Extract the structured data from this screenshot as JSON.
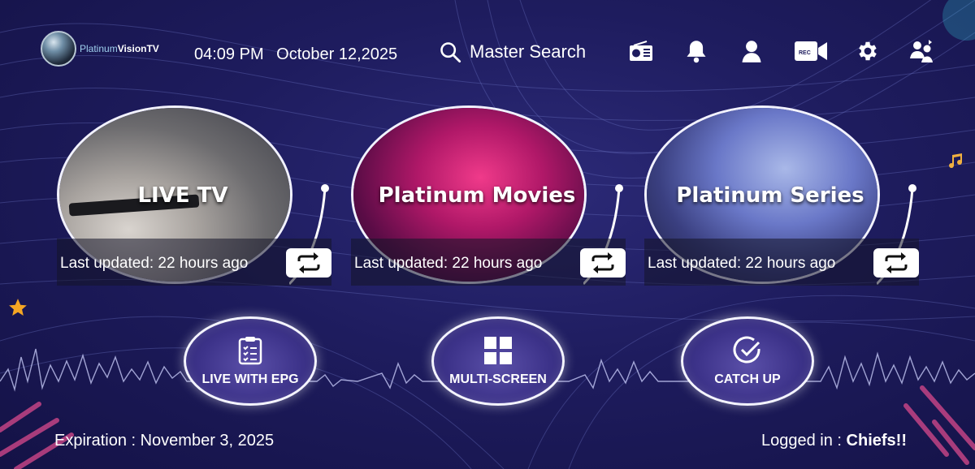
{
  "header": {
    "logo": {
      "name_part1": "Platinum",
      "name_part2": "VisionTV"
    },
    "time": "04:09 PM",
    "date": "October 12,2025",
    "search_label": "Master Search",
    "icons": [
      "radio-icon",
      "bell-icon",
      "user-icon",
      "rec-camera-icon",
      "gear-icon",
      "switch-user-icon"
    ],
    "rec_text": "REC"
  },
  "cards": [
    {
      "title": "LIVE TV",
      "updated": "Last updated: 22 hours ago"
    },
    {
      "title": "Platinum Movies",
      "updated": "Last updated: 22 hours ago"
    },
    {
      "title": "Platinum Series",
      "updated": "Last updated: 22 hours ago"
    }
  ],
  "features": [
    {
      "label": "LIVE WITH EPG",
      "icon": "clipboard-checklist-icon"
    },
    {
      "label": "MULTI-SCREEN",
      "icon": "grid-icon"
    },
    {
      "label": "CATCH UP",
      "icon": "check-circle-icon"
    }
  ],
  "footer": {
    "expiration": "Expiration : November 3, 2025",
    "logged_in_prefix": "Logged in :",
    "username": "Chiefs!!"
  },
  "colors": {
    "background": "#1e1c5e",
    "accent_pink": "#d94a8c",
    "star": "#f5a623"
  }
}
